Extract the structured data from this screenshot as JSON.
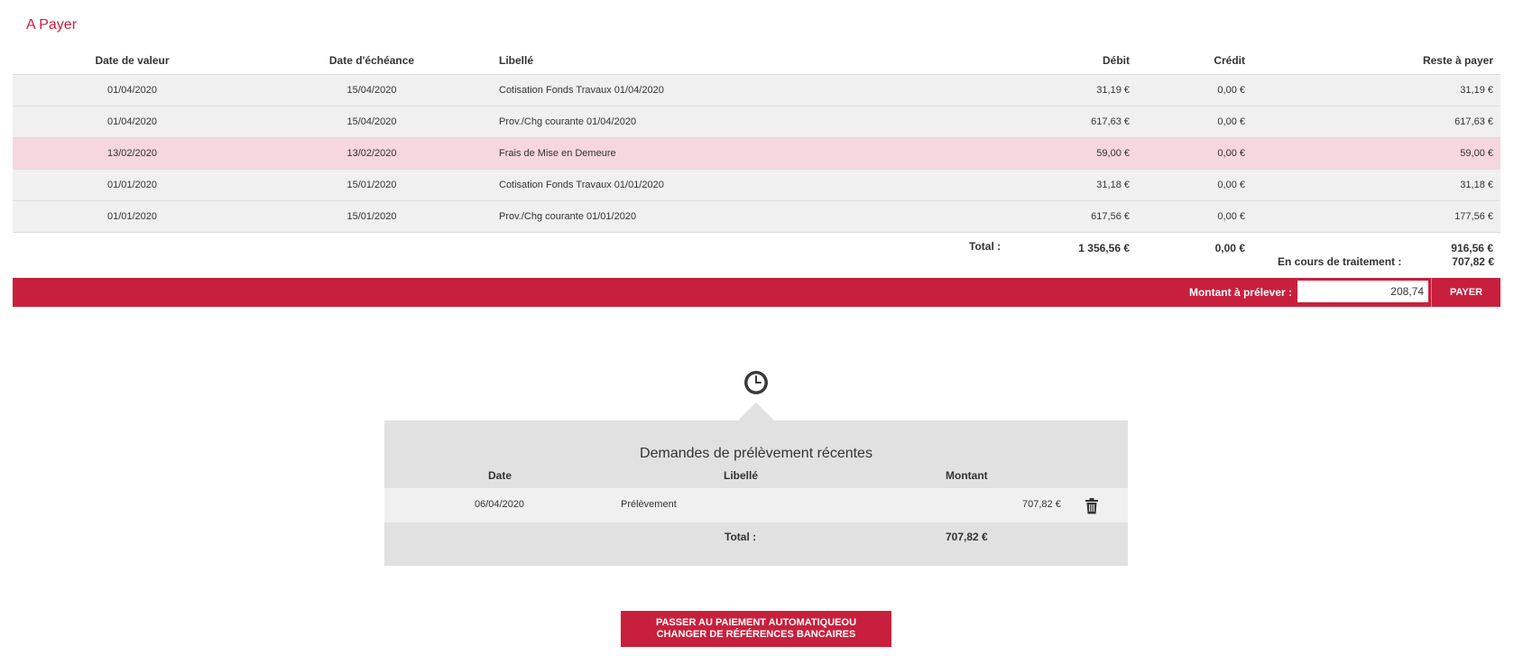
{
  "section_title": "A Payer",
  "columns": {
    "date_valeur": "Date de valeur",
    "date_echeance": "Date d'échéance",
    "libelle": "Libellé",
    "debit": "Débit",
    "credit": "Crédit",
    "reste": "Reste à payer"
  },
  "rows": [
    {
      "date_valeur": "01/04/2020",
      "date_echeance": "15/04/2020",
      "libelle": "Cotisation Fonds Travaux 01/04/2020",
      "debit": "31,19 €",
      "credit": "0,00 €",
      "reste": "31,19 €"
    },
    {
      "date_valeur": "01/04/2020",
      "date_echeance": "15/04/2020",
      "libelle": "Prov./Chg courante 01/04/2020",
      "debit": "617,63 €",
      "credit": "0,00 €",
      "reste": "617,63 €"
    },
    {
      "date_valeur": "13/02/2020",
      "date_echeance": "13/02/2020",
      "libelle": "Frais de Mise en Demeure",
      "debit": "59,00 €",
      "credit": "0,00 €",
      "reste": "59,00 €"
    },
    {
      "date_valeur": "01/01/2020",
      "date_echeance": "15/01/2020",
      "libelle": "Cotisation Fonds Travaux 01/01/2020",
      "debit": "31,18 €",
      "credit": "0,00 €",
      "reste": "31,18 €"
    },
    {
      "date_valeur": "01/01/2020",
      "date_echeance": "15/01/2020",
      "libelle": "Prov./Chg courante 01/01/2020",
      "debit": "617,56 €",
      "credit": "0,00 €",
      "reste": "177,56 €"
    }
  ],
  "totals": {
    "label": "Total :",
    "debit": "1 356,56 €",
    "credit": "0,00 €",
    "reste": "916,56 €"
  },
  "processing": {
    "label": "En cours de traitement :",
    "value": "707,82 €"
  },
  "pay_bar": {
    "amount_label": "Montant à prélever :",
    "amount_value": "208,74",
    "button": "PAYER"
  },
  "recent": {
    "title": "Demandes de prélèvement récentes",
    "columns": {
      "date": "Date",
      "libelle": "Libellé",
      "montant": "Montant"
    },
    "rows": [
      {
        "date": "06/04/2020",
        "libelle": "Prélèvement",
        "montant": "707,82 €"
      }
    ],
    "total_label": "Total :",
    "total_value": "707,82 €"
  },
  "autopay_button": {
    "line1": "PASSER AU PAIEMENT AUTOMATIQUEOU",
    "line2": "CHANGER DE RÉFÉRENCES BANCAIRES"
  },
  "colors": {
    "accent": "#c8203c",
    "row_bg": "#f0f0f0",
    "highlight_row_bg": "#f5d7dd",
    "panel_bg": "#e1e1e1"
  },
  "icons": {
    "clock": "clock-icon",
    "trash": "trash-icon"
  }
}
